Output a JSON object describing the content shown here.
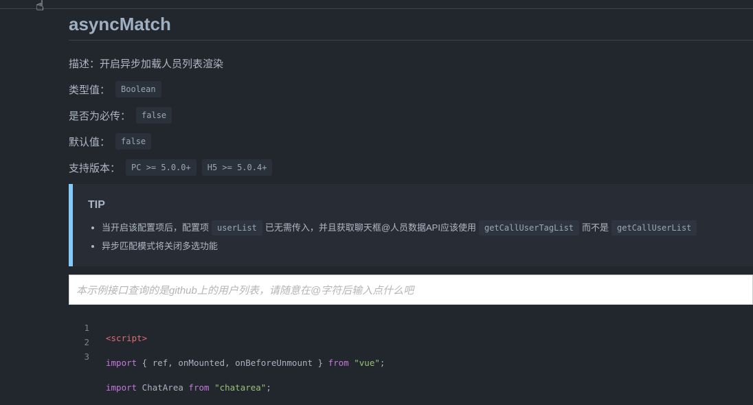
{
  "title": "asyncMatch",
  "rows": [
    {
      "label": "描述：",
      "text": "开启异步加载人员列表渲染"
    },
    {
      "label": "类型值：",
      "code": [
        "Boolean"
      ]
    },
    {
      "label": "是否为必传：",
      "code": [
        "false"
      ]
    },
    {
      "label": "默认值：",
      "code": [
        "false"
      ]
    },
    {
      "label": "支持版本：",
      "code": [
        "PC >= 5.0.0+",
        "H5 >= 5.0.4+"
      ]
    }
  ],
  "tip": {
    "heading": "TIP",
    "item1": {
      "a": "当开启该配置项后，配置项",
      "c1": "userList",
      "b": "已无需传入，并且获取聊天框@人员数据API应该使用",
      "c2": "getCallUserTagList",
      "d": "而不是",
      "c3": "getCallUserList"
    },
    "item2": "异步匹配模式将关闭多选功能"
  },
  "input": {
    "placeholder": "本示例接口查询的是github上的用户列表，请随意在@字符后输入点什么吧"
  },
  "code": {
    "lines": [
      "1",
      "2",
      "3"
    ],
    "l1": "<script>",
    "l2": {
      "a": "import",
      "b": " { ref, onMounted, onBeforeUnmount } ",
      "c": "from",
      "d": "\"vue\"",
      "e": ";"
    },
    "l3": {
      "a": "import",
      "b": " ChatArea ",
      "c": "from",
      "d": "\"chatarea\"",
      "e": ";"
    }
  }
}
